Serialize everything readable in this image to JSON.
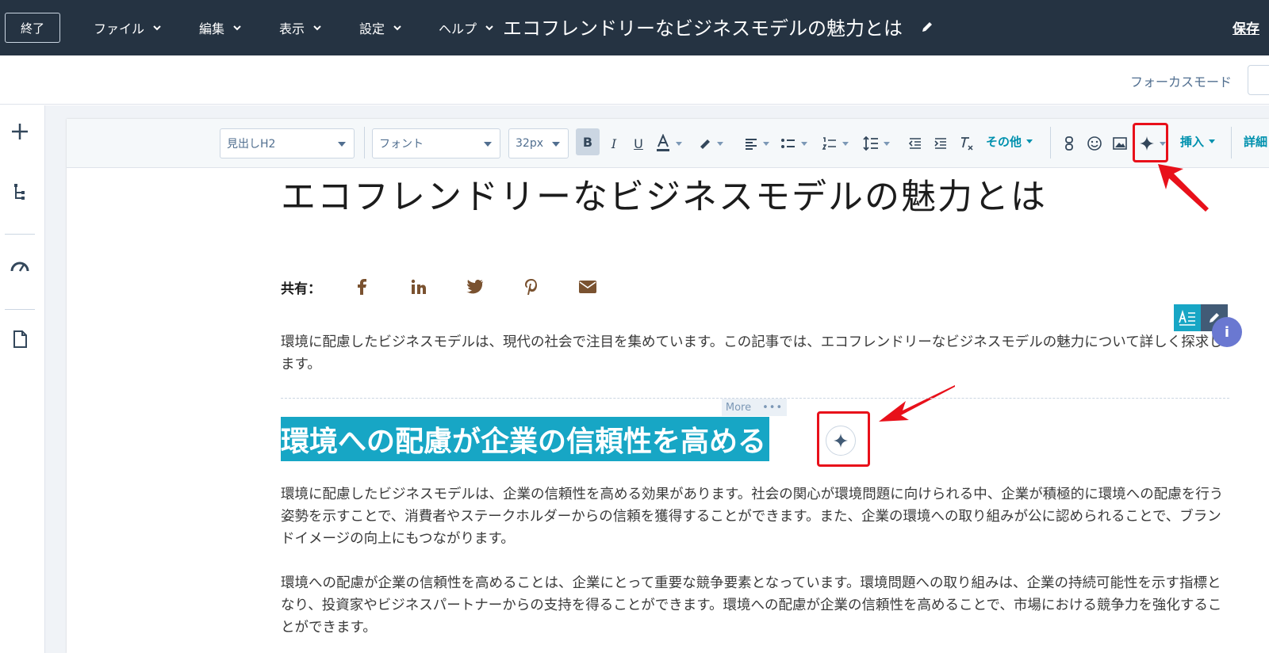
{
  "topbar": {
    "exit_label": "終了",
    "menus": [
      {
        "label": "ファイル"
      },
      {
        "label": "編集"
      },
      {
        "label": "表示"
      },
      {
        "label": "設定"
      },
      {
        "label": "ヘルプ"
      }
    ],
    "document_title": "エコフレンドリーなビジネスモデルの魅力とは",
    "save_label": "保存"
  },
  "subbar": {
    "focus_mode_label": "フォーカスモード"
  },
  "sidebar": {
    "icons": [
      "plus-icon",
      "tree-structure-icon",
      "speedometer-icon",
      "document-icon"
    ]
  },
  "toolbar": {
    "style_select": "見出しH2",
    "font_select": "フォント",
    "size_select": "32px",
    "bold": "B",
    "italic": "I",
    "underline": "U",
    "more_label": "その他",
    "insert_label": "挿入",
    "details_label": "詳細"
  },
  "content": {
    "title": "エコフレンドリーなビジネスモデルの魅力とは",
    "share_label": "共有：",
    "share_icons": [
      "facebook-icon",
      "linkedin-icon",
      "twitter-icon",
      "pinterest-icon",
      "email-icon"
    ],
    "intro": "環境に配慮したビジネスモデルは、現代の社会で注目を集めています。この記事では、エコフレンドリーなビジネスモデルの魅力について詳しく探求します。",
    "more_tab": "More",
    "heading2": "環境への配慮が企業の信頼性を高める",
    "para1": "環境に配慮したビジネスモデルは、企業の信頼性を高める効果があります。社会の関心が環境問題に向けられる中、企業が積極的に環境への配慮を行う姿勢を示すことで、消費者やステークホルダーからの信頼を獲得することができます。また、企業の環境への取り組みが公に認められることで、ブランドイメージの向上にもつながります。",
    "para2": "環境への配慮が企業の信頼性を高めることは、企業にとって重要な競争要素となっています。環境問題への取り組みは、企業の持続可能性を示す指標となり、投資家やビジネスパートナーからの支持を得ることができます。環境への配慮が企業の信頼性を高めることで、市場における競争力を強化することができます。"
  },
  "floating": {
    "info_label": "i"
  },
  "colors": {
    "topbar": "#253342",
    "highlight": "#17a6c5",
    "annotation_red": "#e8101a",
    "accent_teal": "#0091ae"
  }
}
